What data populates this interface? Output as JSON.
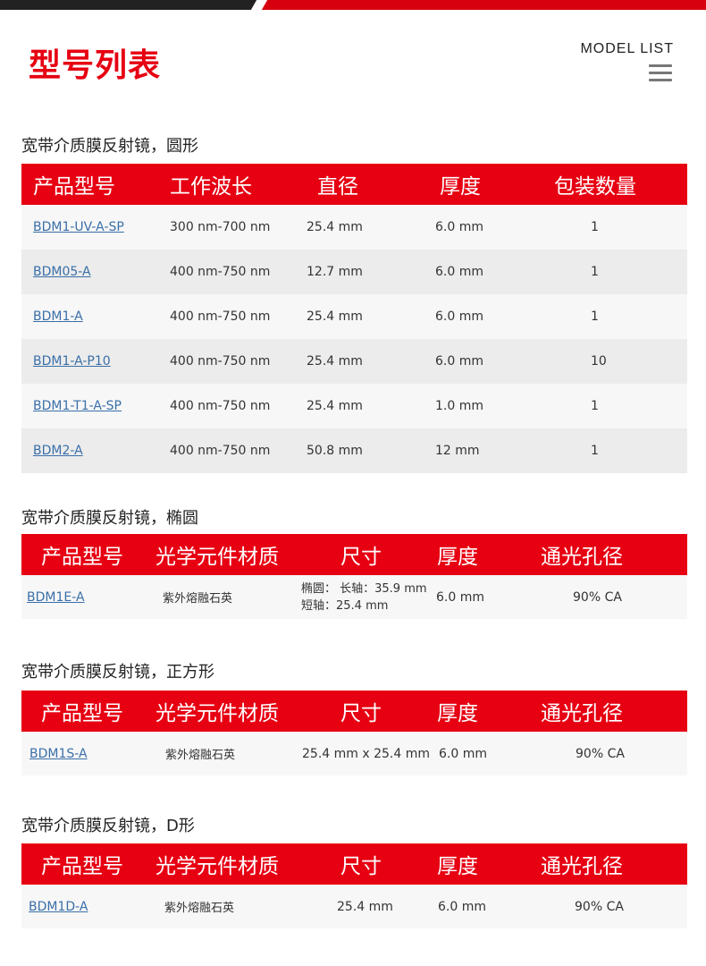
{
  "colors": {
    "accent": "#e60012",
    "dark": "#222222",
    "link": "#3a6fa8",
    "row_odd": "#f7f7f7",
    "row_even": "#ececec"
  },
  "header": {
    "title": "型号列表",
    "model_list_label": "MODEL LIST",
    "menu_icon": "hamburger-icon"
  },
  "sections": [
    {
      "title": "宽带介质膜反射镜，圆形",
      "headers": [
        "产品型号",
        "工作波长",
        "直径",
        "厚度",
        "包装数量"
      ],
      "rows": [
        [
          "BDM1-UV-A-SP",
          "300 nm-700 nm",
          "25.4 mm",
          "6.0 mm",
          "1"
        ],
        [
          "BDM05-A",
          "400 nm-750 nm",
          "12.7 mm",
          "6.0 mm",
          "1"
        ],
        [
          "BDM1-A",
          "400 nm-750 nm",
          "25.4 mm",
          "6.0 mm",
          "1"
        ],
        [
          "BDM1-A-P10",
          "400 nm-750 nm",
          "25.4 mm",
          "6.0 mm",
          "10"
        ],
        [
          "BDM1-T1-A-SP",
          "400 nm-750 nm",
          "25.4 mm",
          "1.0 mm",
          "1"
        ],
        [
          "BDM2-A",
          "400 nm-750 nm",
          "50.8 mm",
          "12 mm",
          "1"
        ]
      ]
    },
    {
      "title": "宽带介质膜反射镜，椭圆",
      "headers": [
        "产品型号",
        "光学元件材质",
        "尺寸",
        "厚度",
        "通光孔径"
      ],
      "rows": [
        [
          "BDM1E-A",
          "紫外熔融石英",
          "椭圆： 长轴：35.9 mm 短轴：25.4 mm",
          "6.0 mm",
          "90% CA"
        ]
      ]
    },
    {
      "title": "宽带介质膜反射镜，正方形",
      "headers": [
        "产品型号",
        "光学元件材质",
        "尺寸",
        "厚度",
        "通光孔径"
      ],
      "rows": [
        [
          "BDM1S-A",
          "紫外熔融石英",
          "25.4 mm x 25.4 mm",
          "6.0 mm",
          "90% CA"
        ]
      ]
    },
    {
      "title": "宽带介质膜反射镜，D形",
      "headers": [
        "产品型号",
        "光学元件材质",
        "尺寸",
        "厚度",
        "通光孔径"
      ],
      "rows": [
        [
          "BDM1D-A",
          "紫外熔融石英",
          "25.4 mm",
          "6.0 mm",
          "90% CA"
        ]
      ]
    }
  ]
}
